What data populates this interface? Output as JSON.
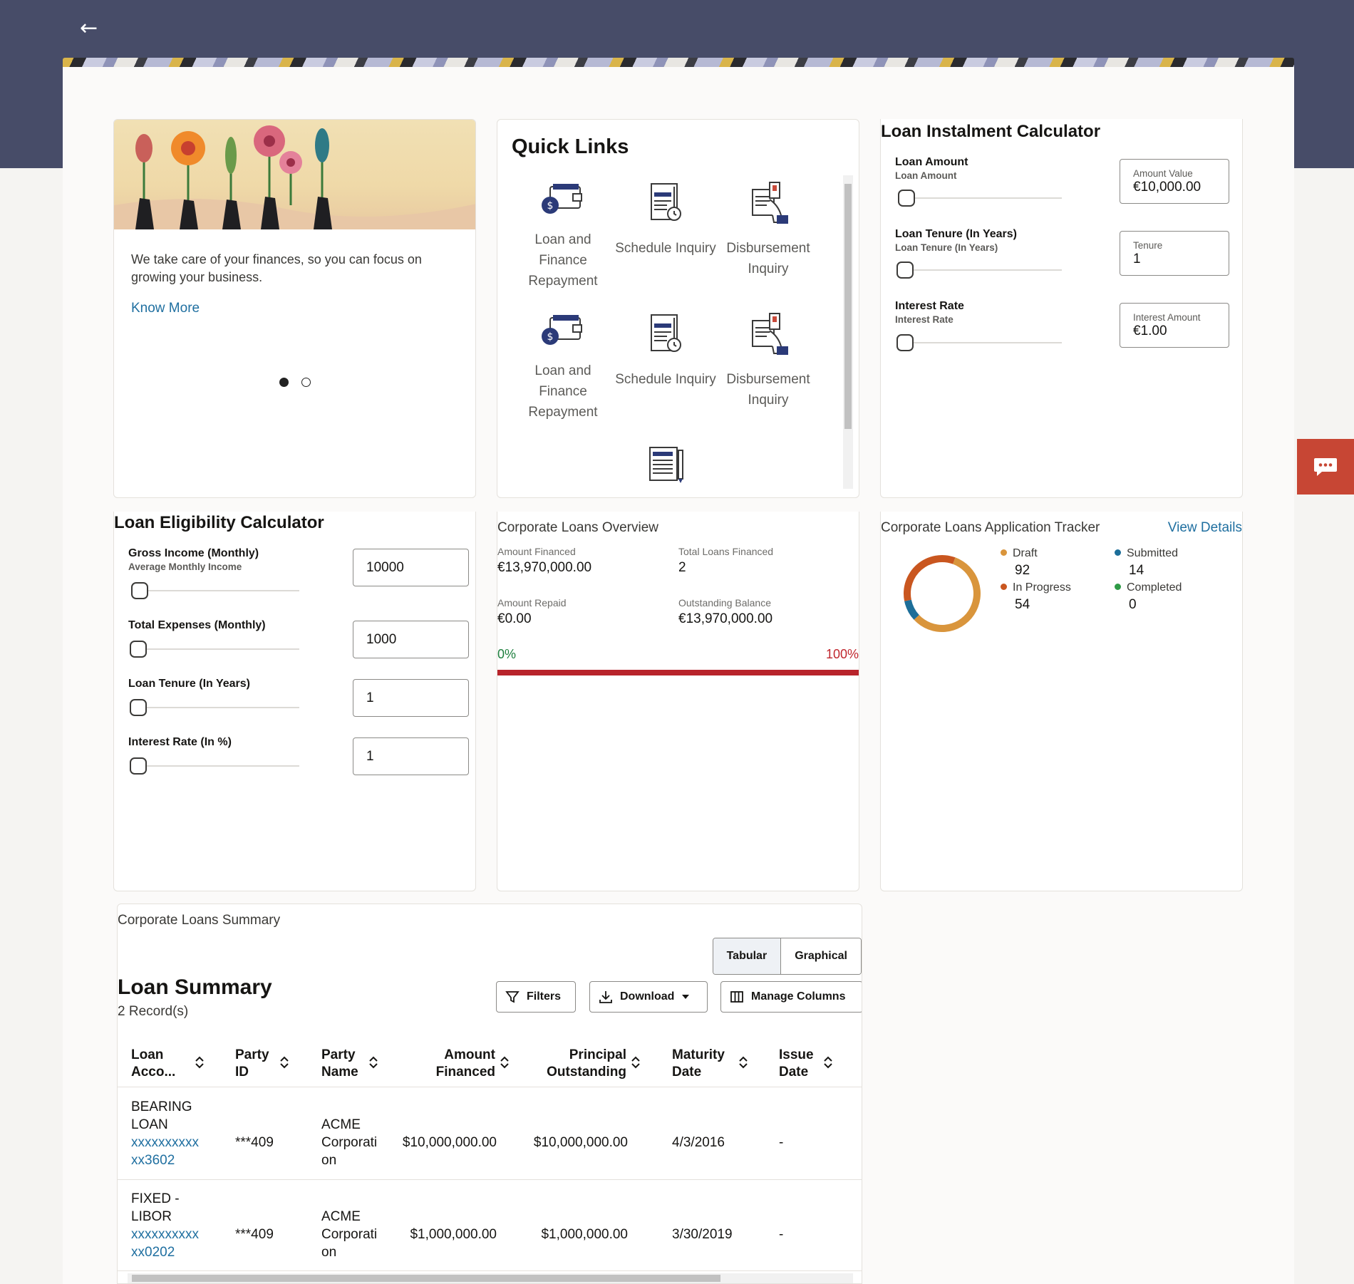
{
  "nav": {
    "back_icon": "arrow-left-icon"
  },
  "promo": {
    "text": "We take care of your finances, so you can focus on growing your business.",
    "link": "Know More",
    "slides": 2,
    "active_slide": 1
  },
  "quick_links": {
    "title": "Quick Links",
    "items": [
      {
        "label": "Loan and Finance Repayment",
        "icon": "wallet-icon"
      },
      {
        "label": "Schedule Inquiry",
        "icon": "schedule-document-icon"
      },
      {
        "label": "Disbursement Inquiry",
        "icon": "disbursement-icon"
      },
      {
        "label": "Loan and Finance Repayment",
        "icon": "wallet-icon"
      },
      {
        "label": "Schedule Inquiry",
        "icon": "schedule-document-icon"
      },
      {
        "label": "Disbursement Inquiry",
        "icon": "disbursement-icon"
      },
      {
        "label": "",
        "icon": "newspaper-icon"
      }
    ]
  },
  "instalment": {
    "title": "Loan Instalment Calculator",
    "amount": {
      "label": "Loan Amount",
      "sub": "Loan Amount",
      "box_label": "Amount Value",
      "value": "€10,000.00"
    },
    "tenure": {
      "label": "Loan Tenure (In Years)",
      "sub": "Loan Tenure (In Years)",
      "box_label": "Tenure",
      "value": "1"
    },
    "rate": {
      "label": "Interest Rate",
      "sub": "Interest Rate",
      "box_label": "Interest Amount",
      "value": "€1.00"
    }
  },
  "eligibility": {
    "title": "Loan Eligibility Calculator",
    "gross": {
      "label": "Gross Income (Monthly)",
      "sub": "Average Monthly Income",
      "value": "10000"
    },
    "expenses": {
      "label": "Total Expenses (Monthly)",
      "value": "1000"
    },
    "tenure": {
      "label": "Loan Tenure (In Years)",
      "value": "1"
    },
    "rate": {
      "label": "Interest Rate (In %)",
      "value": "1"
    }
  },
  "overview": {
    "title": "Corporate Loans Overview",
    "amount_financed_label": "Amount Financed",
    "amount_financed": "€13,970,000.00",
    "total_loans_label": "Total Loans Financed",
    "total_loans": "2",
    "amount_repaid_label": "Amount Repaid",
    "amount_repaid": "€0.00",
    "outstanding_label": "Outstanding Balance",
    "outstanding": "€13,970,000.00",
    "start_pct": "0%",
    "end_pct": "100%",
    "repaid_fraction": 0
  },
  "tracker": {
    "title": "Corporate Loans Application Tracker",
    "link": "View Details",
    "items": [
      {
        "label": "Draft",
        "value": "92",
        "color": "#d9953c"
      },
      {
        "label": "Submitted",
        "value": "14",
        "color": "#1c6e99"
      },
      {
        "label": "In Progress",
        "value": "54",
        "color": "#c9561f"
      },
      {
        "label": "Completed",
        "value": "0",
        "color": "#2e9b46"
      }
    ]
  },
  "summary": {
    "section_title": "Corporate Loans Summary",
    "view_tabular": "Tabular",
    "view_graphical": "Graphical",
    "title": "Loan Summary",
    "count": "2 Record(s)",
    "filters": "Filters",
    "download": "Download",
    "manage": "Manage Columns",
    "columns": [
      {
        "l1": "Loan",
        "l2": "Acco..."
      },
      {
        "l1": "Party",
        "l2": "ID"
      },
      {
        "l1": "Party",
        "l2": "Name"
      },
      {
        "l1": "Amount",
        "l2": "Financed"
      },
      {
        "l1": "Principal",
        "l2": "Outstanding"
      },
      {
        "l1": "Maturity",
        "l2": "Date"
      },
      {
        "l1": "Issue",
        "l2": "Date"
      }
    ],
    "rows": [
      {
        "type1": "BEARING",
        "type2": "LOAN",
        "acc1": "xxxxxxxxxx",
        "acc2": "xx3602",
        "party_id": "***409",
        "name1": "ACME",
        "name2": "Corporati",
        "name3": "on",
        "amount": "$10,000,000.00",
        "principal": "$10,000,000.00",
        "maturity": "4/3/2016",
        "issue": "-"
      },
      {
        "type1": "FIXED -",
        "type2": "LIBOR",
        "acc1": "xxxxxxxxxx",
        "acc2": "xx0202",
        "party_id": "***409",
        "name1": "ACME",
        "name2": "Corporati",
        "name3": "on",
        "amount": "$1,000,000.00",
        "principal": "$1,000,000.00",
        "maturity": "3/30/2019",
        "issue": "-"
      }
    ]
  }
}
